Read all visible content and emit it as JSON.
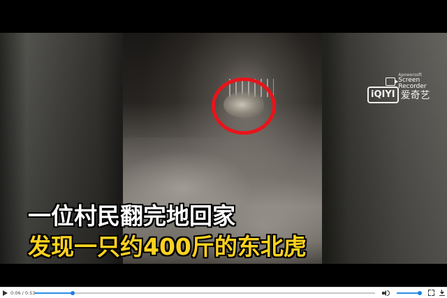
{
  "video": {
    "subtitle_line1": "一位村民翻完地回家",
    "subtitle_line2": "发现一只约400斤的东北虎",
    "subtitle_colors": {
      "line1": "#ffffff",
      "line2": "#ffd21f"
    },
    "highlight_color": "#e8141b",
    "watermarks": {
      "recorder_brand": "Apowersoft",
      "recorder_name": "Screen Recorder",
      "recorder_icon": "camera-icon",
      "iqiyi_logo": "iQIYI",
      "iqiyi_name": "爱奇艺"
    }
  },
  "player": {
    "time_display": "0:06 / 0:53",
    "progress_fraction": 0.113,
    "volume_fraction": 0.92,
    "accent_color": "#2b8ee6",
    "icons": {
      "play": "play-icon",
      "volume": "volume-icon",
      "fullscreen": "fullscreen-icon",
      "download": "download-icon"
    }
  }
}
